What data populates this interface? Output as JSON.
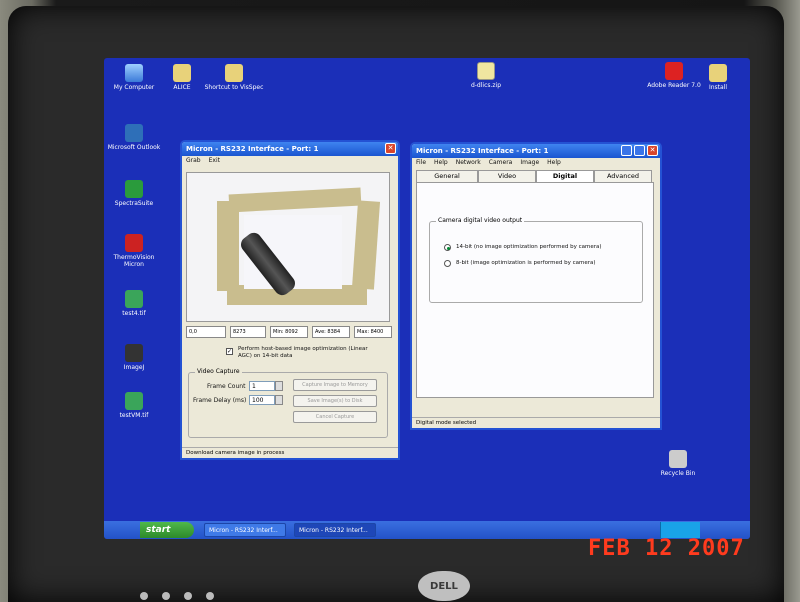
{
  "desktop": {
    "icons": [
      {
        "label": "My Computer",
        "icon": "computer-icon"
      },
      {
        "label": "ALICE",
        "icon": "folder-icon"
      },
      {
        "label": "Shortcut to VisSpec",
        "icon": "folder-shortcut-icon"
      },
      {
        "label": "d-dlics.zip",
        "icon": "zip-icon"
      },
      {
        "label": "Adobe Reader 7.0",
        "icon": "pdf-icon"
      },
      {
        "label": "Install",
        "icon": "folder-icon"
      },
      {
        "label": "Microsoft Outlook",
        "icon": "outlook-icon"
      },
      {
        "label": "SpectraSuite",
        "icon": "spectrasuite-icon"
      },
      {
        "label": "ThermoVision Micron",
        "icon": "thermovision-icon"
      },
      {
        "label": "test4.tif",
        "icon": "tif-file-icon"
      },
      {
        "label": "ImageJ",
        "icon": "imagej-icon"
      },
      {
        "label": "testVM.tif",
        "icon": "tif-file-icon"
      },
      {
        "label": "Recycle Bin",
        "icon": "recycle-bin-icon"
      }
    ]
  },
  "capture_window": {
    "title": "Micron - RS232 Interface - Port: 1",
    "menu": [
      "Grab",
      "Exit"
    ],
    "stats": [
      "0,0",
      "8273",
      "Min: 8092",
      "Ave: 8384",
      "Max: 8400"
    ],
    "checkbox_label": "Perform host-based image optimization (Linear AGC) on 14-bit data",
    "checkbox_checked": true,
    "video_capture": {
      "group_label": "Video Capture",
      "frame_count_label": "Frame Count",
      "frame_count_value": "1",
      "frame_delay_label": "Frame Delay (ms)",
      "frame_delay_value": "100",
      "buttons": [
        "Capture Image to Memory",
        "Save Image(s) to Disk",
        "Cancel Capture"
      ]
    },
    "status": "Download camera image in process"
  },
  "interface_window": {
    "title": "Micron - RS232 Interface - Port: 1",
    "menu": [
      "File",
      "Help",
      "Network",
      "Camera",
      "Image",
      "Help"
    ],
    "tabs": [
      "General",
      "Video",
      "Digital",
      "Advanced"
    ],
    "active_tab": "Digital",
    "group_label": "Camera digital video output",
    "options": [
      {
        "label": "14-bit (no image optimization performed by camera)",
        "selected": true
      },
      {
        "label": "8-bit (image optimization is performed by camera)",
        "selected": false
      }
    ],
    "status": "Digital mode selected"
  },
  "taskbar": {
    "start_label": "start",
    "items": [
      "Micron - RS232 Interf...",
      "Micron - RS232 Interf..."
    ]
  },
  "monitor": {
    "brand": "DELL"
  },
  "photo_timestamp": "FEB 12 2007"
}
